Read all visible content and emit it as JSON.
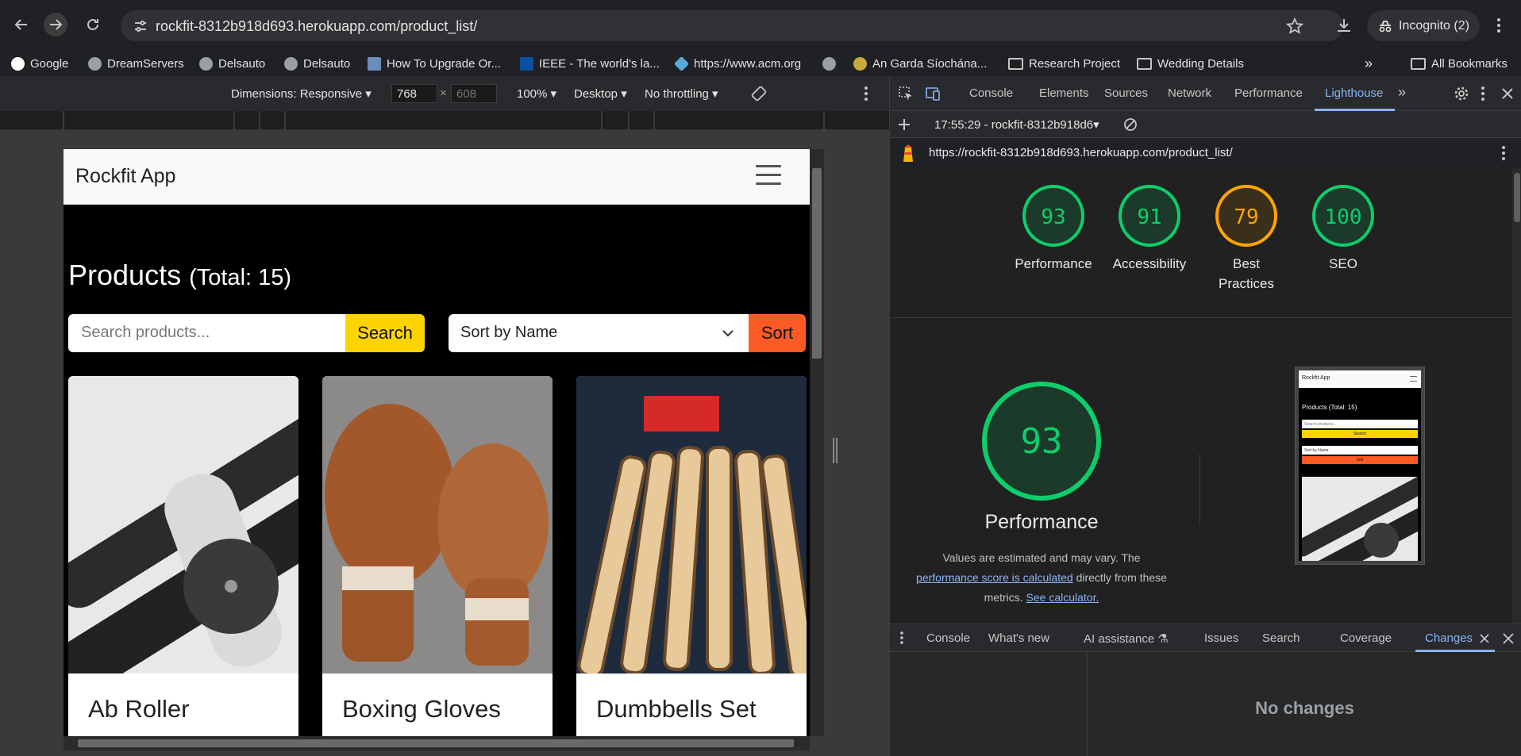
{
  "browser": {
    "url": "rockfit-8312b918d693.herokuapp.com/product_list/",
    "incognito_label": "Incognito (2)",
    "bookmarks": [
      "Google",
      "DreamServers",
      "Delsauto",
      "Delsauto",
      "How To Upgrade Or...",
      "IEEE - The world's la...",
      "https://www.acm.org",
      "An Garda Síochána...",
      "Research Project",
      "Wedding Details"
    ],
    "all_bookmarks": "All Bookmarks"
  },
  "device_toolbar": {
    "dimensions": "Dimensions: Responsive",
    "width": "768",
    "height": "608",
    "zoom": "100%",
    "device_type": "Desktop",
    "throttling": "No throttling"
  },
  "app": {
    "brand": "Rockfit App",
    "title": "Products",
    "total": "(Total: 15)",
    "search_placeholder": "Search products...",
    "search_label": "Search",
    "sort_value": "Sort by Name",
    "sort_label": "Sort",
    "products": [
      "Ab Roller",
      "Boxing Gloves",
      "Dumbbells Set"
    ]
  },
  "devtools": {
    "tabs": [
      "Console",
      "Elements",
      "Sources",
      "Network",
      "Performance",
      "Lighthouse"
    ],
    "report_time": "17:55:29 - rockfit-8312b918d6",
    "report_url": "https://rockfit-8312b918d693.herokuapp.com/product_list/",
    "scores": [
      {
        "label": "Performance",
        "value": "93",
        "color": "#0cce6b"
      },
      {
        "label": "Accessibility",
        "value": "91",
        "color": "#0cce6b"
      },
      {
        "label": "Best Practices",
        "value": "79",
        "color": "#ffa400"
      },
      {
        "label": "SEO",
        "value": "100",
        "color": "#0cce6b"
      }
    ],
    "perf_score": "93",
    "perf_title": "Performance",
    "perf_note_1": "Values are estimated and may vary. The",
    "perf_link": "performance score is calculated",
    "perf_note_2": "directly from these",
    "perf_note_3": "metrics.",
    "calc_link": "See calculator.",
    "preview": {
      "brand": "Rockfit App",
      "title": "Products (Total: 15)",
      "search_placeholder": "Search products...",
      "search": "Search",
      "sort_value": "Sort by Name",
      "sort": "Sort"
    },
    "drawer_tabs": [
      "Console",
      "What's new",
      "AI assistance",
      "Issues",
      "Search",
      "Coverage",
      "Changes"
    ],
    "no_changes": "No changes"
  }
}
